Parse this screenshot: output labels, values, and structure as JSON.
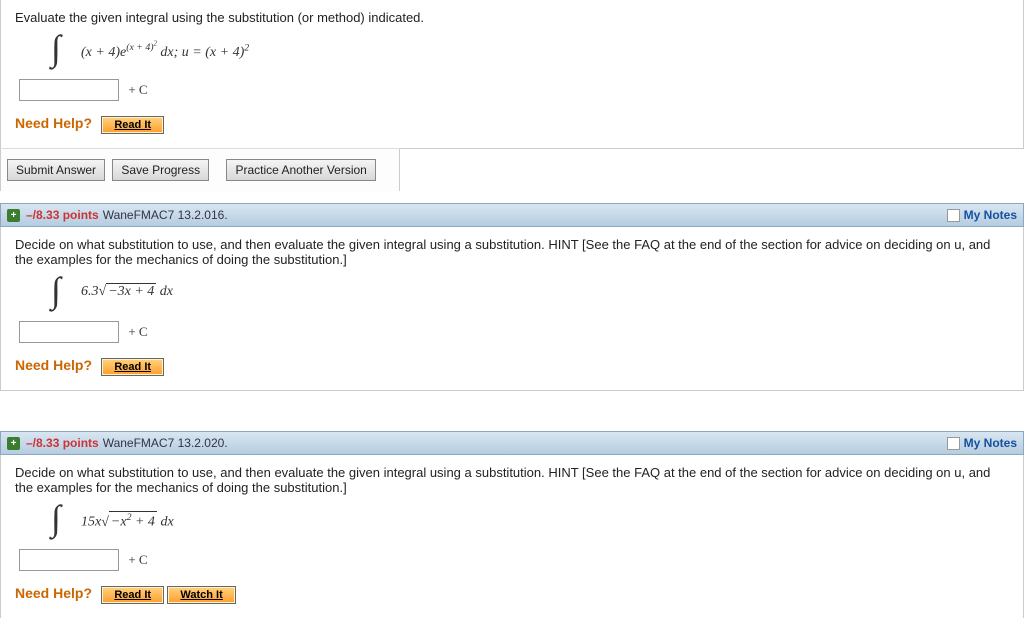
{
  "q1": {
    "prompt": "Evaluate the given integral using the substitution (or method) indicated.",
    "integrand_html": "(x + 4)e<sup>(x + 4)<sup>2</sup></sup> dx; u = (x + 4)<sup>2</sup>",
    "plus_c": "+ C",
    "need_help": "Need Help?",
    "read_it": "Read It"
  },
  "actions": {
    "submit": "Submit Answer",
    "save": "Save Progress",
    "practice": "Practice Another Version"
  },
  "q2": {
    "points_text": "–/8.33 points",
    "ref": "WaneFMAC7 13.2.016.",
    "mynotes": "My Notes",
    "prompt": "Decide on what substitution to use, and then evaluate the given integral using a substitution. HINT [See the FAQ at the end of the section for advice on deciding on u, and the examples for the mechanics of doing the substitution.]",
    "integrand_prefix": "6.3",
    "integrand_sqrt": "−3x + 4",
    "integrand_suffix": " dx",
    "plus_c": "+ C",
    "need_help": "Need Help?",
    "read_it": "Read It"
  },
  "q3": {
    "points_text": "–/8.33 points",
    "ref": "WaneFMAC7 13.2.020.",
    "mynotes": "My Notes",
    "prompt": "Decide on what substitution to use, and then evaluate the given integral using a substitution. HINT [See the FAQ at the end of the section for advice on deciding on u, and the examples for the mechanics of doing the substitution.]",
    "integrand_prefix": "15x",
    "integrand_sqrt_html": "−x<sup>2</sup> + 4",
    "integrand_suffix": " dx",
    "plus_c": "+ C",
    "need_help": "Need Help?",
    "read_it": "Read It",
    "watch_it": "Watch It"
  }
}
